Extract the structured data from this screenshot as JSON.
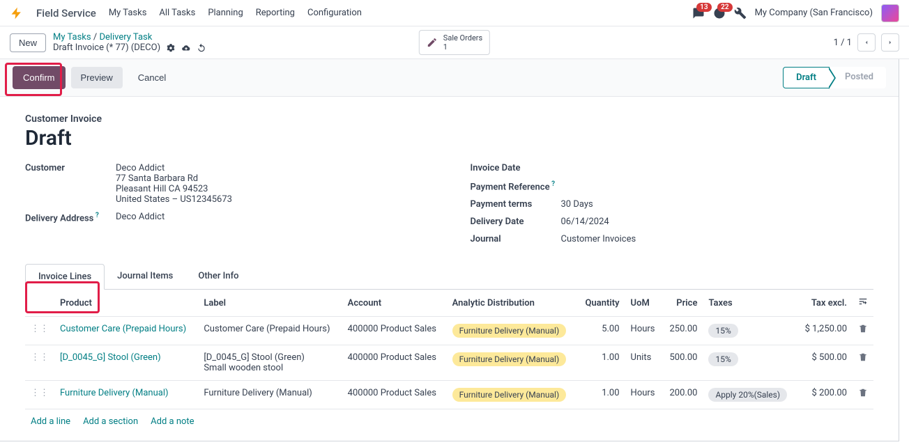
{
  "app": {
    "title": "Field Service",
    "menu": [
      "My Tasks",
      "All Tasks",
      "Planning",
      "Reporting",
      "Configuration"
    ]
  },
  "header": {
    "chat_badge": "13",
    "clock_badge": "22",
    "company": "My Company (San Francisco)"
  },
  "control": {
    "new_btn": "New",
    "crumb1": "My Tasks",
    "crumb2": "Delivery Task",
    "title": "Draft Invoice (* 77) (DECO)",
    "smart_title": "Sale Orders",
    "smart_count": "1",
    "pager": "1 / 1"
  },
  "statusbar": {
    "confirm": "Confirm",
    "preview": "Preview",
    "cancel": "Cancel",
    "draft": "Draft",
    "posted": "Posted"
  },
  "form": {
    "doc_label": "Customer Invoice",
    "doc_title": "Draft",
    "left": {
      "customer_label": "Customer",
      "customer_name": "Deco Addict",
      "addr1": "77 Santa Barbara Rd",
      "addr2": "Pleasant Hill CA 94523",
      "addr3": "United States – US12345673",
      "delivery_label": "Delivery Address",
      "delivery_value": "Deco Addict"
    },
    "right": {
      "invdate_label": "Invoice Date",
      "payref_label": "Payment Reference",
      "payterms_label": "Payment terms",
      "payterms_value": "30 Days",
      "deldate_label": "Delivery Date",
      "deldate_value": "06/14/2024",
      "journal_label": "Journal",
      "journal_value": "Customer Invoices"
    }
  },
  "tabs": {
    "t1": "Invoice Lines",
    "t2": "Journal Items",
    "t3": "Other Info"
  },
  "table": {
    "headers": {
      "product": "Product",
      "label": "Label",
      "account": "Account",
      "analytic": "Analytic Distribution",
      "qty": "Quantity",
      "uom": "UoM",
      "price": "Price",
      "taxes": "Taxes",
      "taxexcl": "Tax excl."
    },
    "rows": [
      {
        "product": "Customer Care (Prepaid Hours)",
        "label": "Customer Care (Prepaid Hours)",
        "account": "400000 Product Sales",
        "analytic": "Furniture Delivery (Manual)",
        "qty": "5.00",
        "uom": "Hours",
        "price": "250.00",
        "taxes": "15%",
        "taxexcl": "$ 1,250.00"
      },
      {
        "product": "[D_0045_G] Stool (Green)",
        "label": "[D_0045_G] Stool (Green)\nSmall wooden stool",
        "account": "400000 Product Sales",
        "analytic": "Furniture Delivery (Manual)",
        "qty": "1.00",
        "uom": "Units",
        "price": "500.00",
        "taxes": "15%",
        "taxexcl": "$ 500.00"
      },
      {
        "product": "Furniture Delivery (Manual)",
        "label": "Furniture Delivery (Manual)",
        "account": "400000 Product Sales",
        "analytic": "Furniture Delivery (Manual)",
        "qty": "1.00",
        "uom": "Hours",
        "price": "200.00",
        "taxes": "Apply 20%(Sales)",
        "taxexcl": "$ 200.00"
      }
    ],
    "add_line": "Add a line",
    "add_section": "Add a section",
    "add_note": "Add a note"
  }
}
